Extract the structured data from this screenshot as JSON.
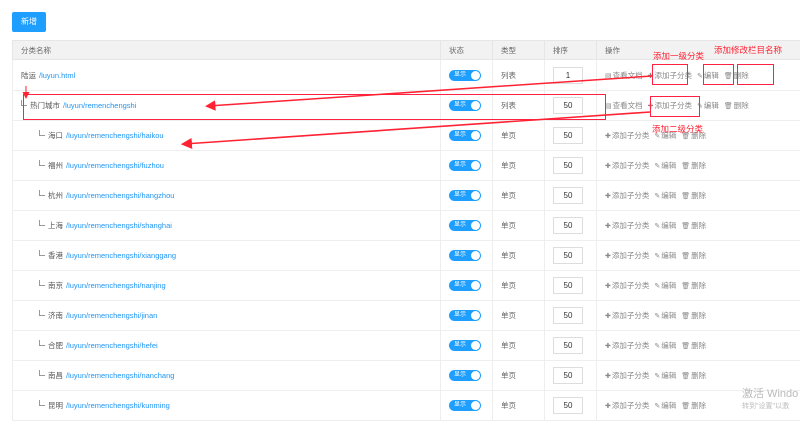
{
  "toolbar": {
    "add_label": "新增"
  },
  "columns": [
    "分类名称",
    "状态",
    "类型",
    "排序",
    "操作"
  ],
  "rows": [
    {
      "level": 0,
      "name": "陆运",
      "path": "/luyun.html",
      "status": "显示",
      "type": "列表",
      "sort": "1",
      "ops": [
        "查看文档",
        "添加子分类",
        "编辑",
        "删除"
      ]
    },
    {
      "level": 1,
      "name": "热门城市",
      "path": "/luyun/remenchengshi",
      "status": "显示",
      "type": "列表",
      "sort": "50",
      "ops": [
        "查看文档",
        "添加子分类",
        "编辑",
        "删除"
      ]
    },
    {
      "level": 2,
      "name": "海口",
      "path": "/luyun/remenchengshi/haikou",
      "status": "显示",
      "type": "单页",
      "sort": "50",
      "ops": [
        "添加子分类",
        "编辑",
        "删除"
      ]
    },
    {
      "level": 2,
      "name": "福州",
      "path": "/luyun/remenchengshi/fuzhou",
      "status": "显示",
      "type": "单页",
      "sort": "50",
      "ops": [
        "添加子分类",
        "编辑",
        "删除"
      ]
    },
    {
      "level": 2,
      "name": "杭州",
      "path": "/luyun/remenchengshi/hangzhou",
      "status": "显示",
      "type": "单页",
      "sort": "50",
      "ops": [
        "添加子分类",
        "编辑",
        "删除"
      ]
    },
    {
      "level": 2,
      "name": "上海",
      "path": "/luyun/remenchengshi/shanghai",
      "status": "显示",
      "type": "单页",
      "sort": "50",
      "ops": [
        "添加子分类",
        "编辑",
        "删除"
      ]
    },
    {
      "level": 2,
      "name": "香港",
      "path": "/luyun/remenchengshi/xianggang",
      "status": "显示",
      "type": "单页",
      "sort": "50",
      "ops": [
        "添加子分类",
        "编辑",
        "删除"
      ]
    },
    {
      "level": 2,
      "name": "南京",
      "path": "/luyun/remenchengshi/nanjing",
      "status": "显示",
      "type": "单页",
      "sort": "50",
      "ops": [
        "添加子分类",
        "编辑",
        "删除"
      ]
    },
    {
      "level": 2,
      "name": "济南",
      "path": "/luyun/remenchengshi/jinan",
      "status": "显示",
      "type": "单页",
      "sort": "50",
      "ops": [
        "添加子分类",
        "编辑",
        "删除"
      ]
    },
    {
      "level": 2,
      "name": "合肥",
      "path": "/luyun/remenchengshi/hefei",
      "status": "显示",
      "type": "单页",
      "sort": "50",
      "ops": [
        "添加子分类",
        "编辑",
        "删除"
      ]
    },
    {
      "level": 2,
      "name": "南昌",
      "path": "/luyun/remenchengshi/nanchang",
      "status": "显示",
      "type": "单页",
      "sort": "50",
      "ops": [
        "添加子分类",
        "编辑",
        "删除"
      ]
    },
    {
      "level": 2,
      "name": "昆明",
      "path": "/luyun/remenchengshi/kunming",
      "status": "显示",
      "type": "单页",
      "sort": "50",
      "ops": [
        "添加子分类",
        "编辑",
        "删除"
      ]
    }
  ],
  "op_icons": {
    "查看文档": "document-icon",
    "添加子分类": "plus-icon",
    "编辑": "edit-icon",
    "删除": "trash-icon"
  },
  "annotations": {
    "add_level1": "添加一级分类",
    "edit_name": "添加修改栏目名称",
    "add_level2": "添加二级分类"
  },
  "watermark": {
    "line1": "激活 Windo",
    "line2": "转到\"设置\"以激"
  },
  "colors": {
    "accent": "#1e9fff",
    "link": "#2196f3",
    "annotation": "#ff2233"
  }
}
